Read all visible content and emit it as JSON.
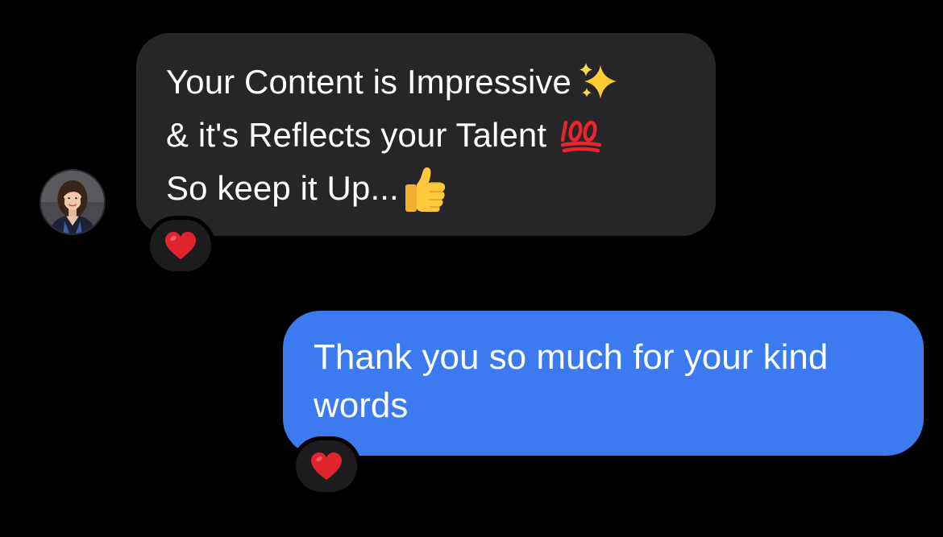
{
  "messages": [
    {
      "direction": "incoming",
      "lines": [
        {
          "text": "Your Content is Impressive",
          "emoji": "sparkles-emoji"
        },
        {
          "text": "& it's Reflects your Talent",
          "emoji": "hundred-points-emoji"
        },
        {
          "text": "So keep it Up...",
          "emoji": "thumbs-up-emoji"
        }
      ],
      "reaction": "red-heart-emoji",
      "bubble_color": "#262628"
    },
    {
      "direction": "outgoing",
      "lines": [
        {
          "text": "Thank you so much for your kind"
        },
        {
          "text": "words"
        }
      ],
      "reaction": "red-heart-emoji",
      "bubble_color": "#3b7bef"
    }
  ],
  "colors": {
    "background": "#000000",
    "reaction_bg": "#1c1c1e",
    "heart": "#e0242e"
  }
}
